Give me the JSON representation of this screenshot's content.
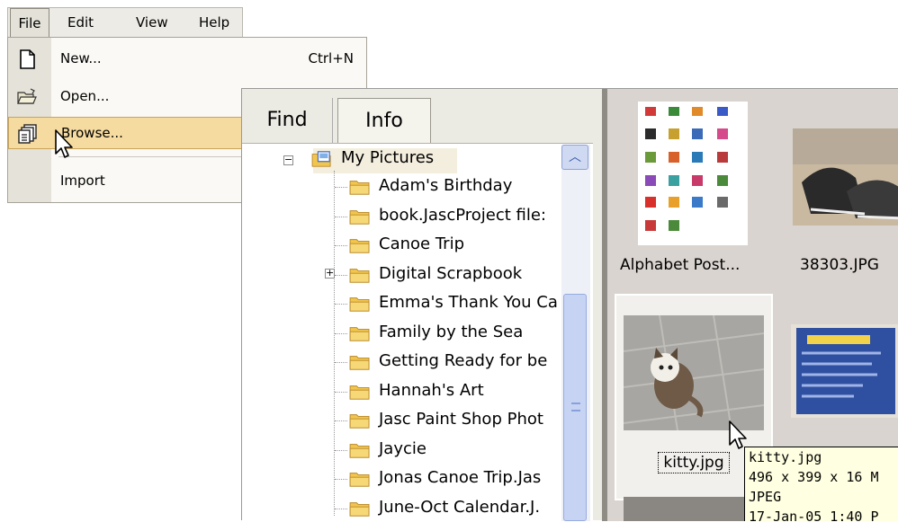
{
  "menubar": {
    "file": "File",
    "edit": "Edit",
    "view": "View",
    "help": "Help"
  },
  "file_menu": {
    "new": {
      "label": "New...",
      "shortcut": "Ctrl+N",
      "icon": "new-document-icon"
    },
    "open": {
      "label": "Open...",
      "icon": "open-folder-icon"
    },
    "browse": {
      "label": "Browse...",
      "icon": "browse-icon"
    },
    "import": {
      "label": "Import"
    }
  },
  "browser": {
    "tabs": [
      "Find",
      "Info"
    ],
    "tree": {
      "root": "My Pictures",
      "folders": [
        "Adam's Birthday",
        "book.JascProject file:",
        "Canoe Trip",
        "Digital Scrapbook",
        "Emma's Thank You Ca",
        "Family by the Sea",
        "Getting Ready for be",
        "Hannah's Art",
        "Jasc Paint Shop Phot",
        "Jaycie",
        "Jonas Canoe Trip.Jas",
        "June-Oct Calendar.J."
      ]
    },
    "thumbnails": [
      {
        "label": "Alphabet Post..."
      },
      {
        "label": "38303.JPG"
      },
      {
        "label": "kitty.jpg"
      },
      {
        "label": ""
      }
    ],
    "tooltip": {
      "name": "kitty.jpg",
      "details": "496 x 399 x 16 M",
      "type": "JPEG",
      "date": "17-Jan-05 1:40 P"
    }
  },
  "colors": {
    "menu_highlight": "#f6dba0",
    "folder": "#f2c64d",
    "tooltip_bg": "#ffffe1"
  }
}
